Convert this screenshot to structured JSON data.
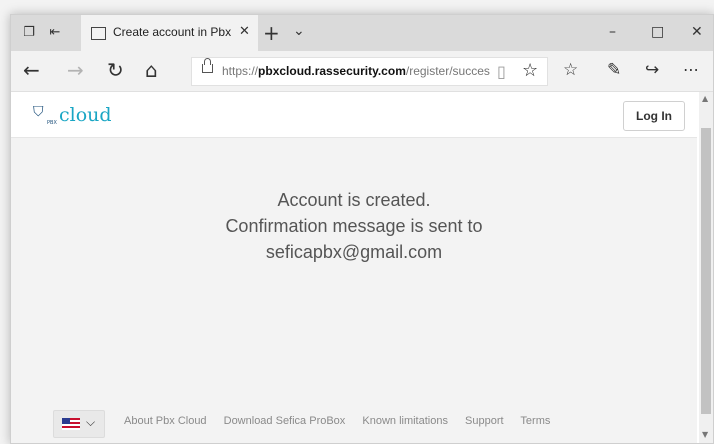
{
  "tab": {
    "title": "Create account in Pbx C"
  },
  "address_bar": {
    "url_prefix": "https://",
    "url_domain": "pbxcloud.rassecurity.com",
    "url_path": "/register/succes"
  },
  "header": {
    "logo_text": "cloud",
    "logo_small": "PBX",
    "login_label": "Log In"
  },
  "message": {
    "line1": "Account is created.",
    "line2": "Confirmation message is sent to",
    "line3": "seficapbx@gmail.com"
  },
  "footer": {
    "language_icon": "us-flag-icon",
    "links": [
      "About Pbx Cloud",
      "Download Sefica ProBox",
      "Known limitations",
      "Support",
      "Terms"
    ]
  },
  "colors": {
    "accent": "#1aa6c4",
    "logo_dark": "#1c4f7a"
  }
}
